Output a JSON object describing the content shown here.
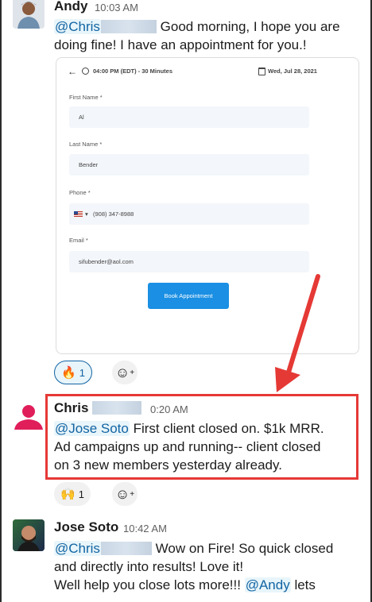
{
  "messages": [
    {
      "author": "Andy",
      "time": "10:03 AM",
      "mention": "@Chris",
      "text_line1": "Good morning, I hope you are",
      "text_line2": "doing fine! I have an appointment for you.!"
    },
    {
      "author": "Chris",
      "time": "0:20 AM",
      "mention": "@Jose Soto",
      "text_line1": "First client closed on. $1k MRR.",
      "text_line2": "Ad campaigns up and running-- client closed",
      "text_line3": "on 3 new members yesterday already."
    },
    {
      "author": "Jose Soto",
      "time": "10:42 AM",
      "mention": "@Chris",
      "text_line1": "Wow on Fire! So quick closed",
      "text_line2": "and directly into results! Love it!",
      "text_line3": "Well help you close lots more!!!",
      "mention2": "@Andy",
      "text_line3_end": "lets"
    }
  ],
  "form": {
    "time_duration": "04:00 PM (EDT) - 30 Minutes",
    "date": "Wed, Jul 28, 2021",
    "first_name_label": "First Name *",
    "first_name_value": "Al",
    "last_name_label": "Last Name *",
    "last_name_value": "Bender",
    "phone_label": "Phone *",
    "phone_value": "(908) 347-8988",
    "email_label": "Email *",
    "email_value": "sifubender@aol.com",
    "book_button": "Book Appointment"
  },
  "reactions": {
    "fire_emoji": "🔥",
    "fire_count": "1",
    "raised_hands_emoji": "🙌",
    "raised_hands_count": "1",
    "add_reaction_icon": "☺"
  },
  "colors": {
    "mention": "#1264a3",
    "highlight": "#e53935",
    "button": "#1a8fe3"
  }
}
